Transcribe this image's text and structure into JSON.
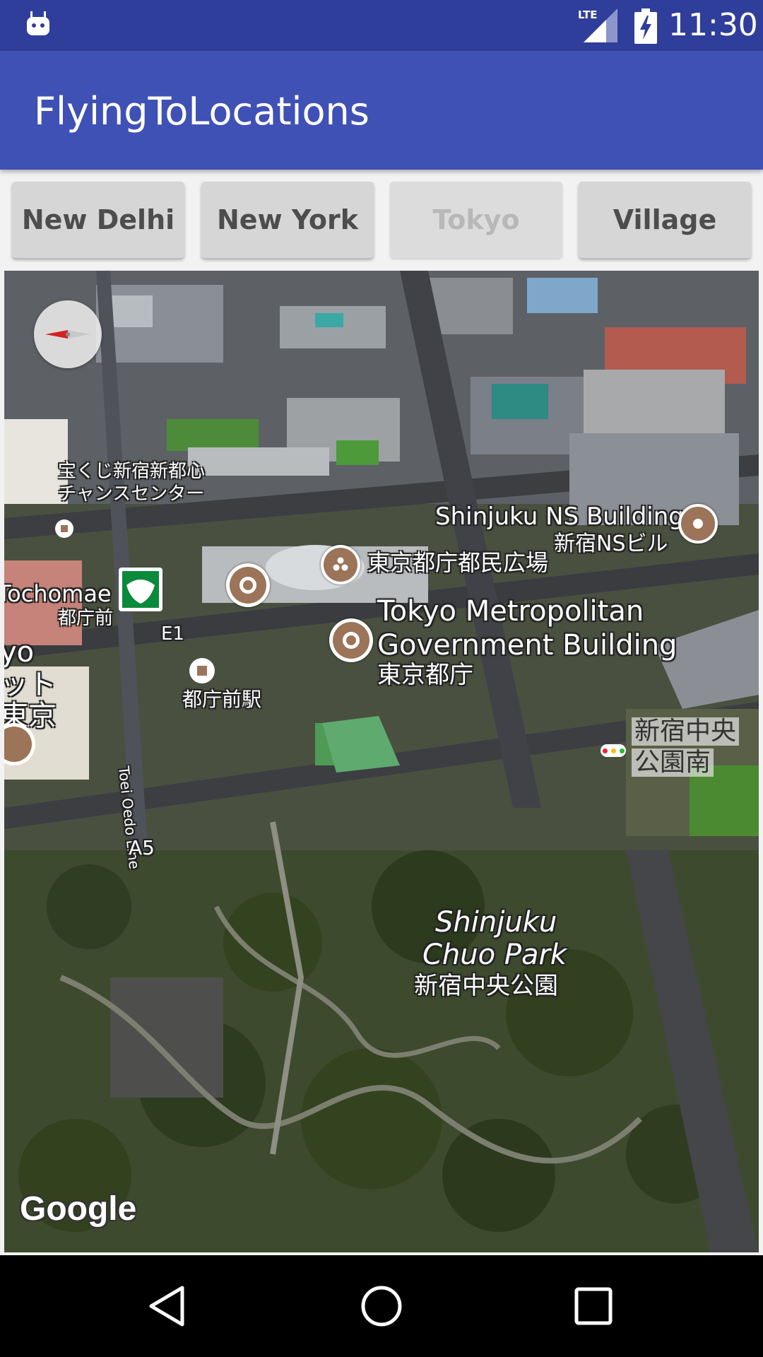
{
  "status_bar": {
    "time": "11:30",
    "network_label": "LTE",
    "icons": [
      "android-notification-icon",
      "lte-signal-icon",
      "battery-charging-icon"
    ]
  },
  "app_bar": {
    "title": "FlyingToLocations"
  },
  "buttons": [
    {
      "label": "New Delhi",
      "enabled": true
    },
    {
      "label": "New York",
      "enabled": true
    },
    {
      "label": "Tokyo",
      "enabled": false
    },
    {
      "label": "Village",
      "enabled": true
    }
  ],
  "map": {
    "labels": {
      "takarakuji_1": "宝くじ新宿新都心",
      "takarakuji_2": "チャンスセンター",
      "ns_building_en": "Shinjuku NS Building",
      "ns_building_ja": "新宿NSビル",
      "tochomae_en": "Tochomae",
      "tochomae_ja": "都庁前",
      "plaza_ja": "東京都庁都民広場",
      "tmg_en_1": "Tokyo Metropolitan",
      "tmg_en_2": "Government Building",
      "tmg_ja": "東京都庁",
      "exit_e1": "E1",
      "tochomae_station": "都庁前駅",
      "tokyo_partial_1": "yo",
      "tokyo_partial_2": "ット",
      "tokyo_partial_3": "東京",
      "park_south_1": "新宿中央",
      "park_south_2": "公園南",
      "oedo_line": "Toei Oedo Line",
      "exit_a5": "A5",
      "park_en_1": "Shinjuku",
      "park_en_2": "Chuo Park",
      "park_ja": "新宿中央公園"
    },
    "attribution": "Google",
    "poi_color": "#9b7459",
    "subway_logo_color": "#0a8a3a"
  },
  "nav_bar": {
    "icons": [
      "back-icon",
      "home-icon",
      "recents-icon"
    ]
  },
  "colors": {
    "status_bar": "#2f3e9a",
    "app_bar": "#3f51b5",
    "button": "#d6d6d6"
  }
}
